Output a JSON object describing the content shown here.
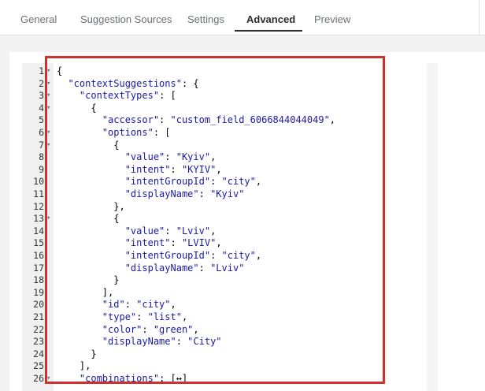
{
  "tabs": [
    {
      "label": "General",
      "active": false
    },
    {
      "label": "Suggestion Sources",
      "active": false
    },
    {
      "label": "Settings",
      "active": false
    },
    {
      "label": "Advanced",
      "active": true
    },
    {
      "label": "Preview",
      "active": false
    }
  ],
  "editor": {
    "lines": [
      {
        "num": "1",
        "fold": true,
        "text": "{"
      },
      {
        "num": "2",
        "fold": true,
        "text": "  \"contextSuggestions\": {"
      },
      {
        "num": "3",
        "fold": true,
        "text": "    \"contextTypes\": ["
      },
      {
        "num": "4",
        "fold": true,
        "text": "      {"
      },
      {
        "num": "5",
        "fold": false,
        "text": "        \"accessor\": \"custom_field_6066844044049\","
      },
      {
        "num": "6",
        "fold": true,
        "text": "        \"options\": ["
      },
      {
        "num": "7",
        "fold": true,
        "text": "          {"
      },
      {
        "num": "8",
        "fold": false,
        "text": "            \"value\": \"Kyiv\","
      },
      {
        "num": "9",
        "fold": false,
        "text": "            \"intent\": \"KYIV\","
      },
      {
        "num": "10",
        "fold": false,
        "text": "            \"intentGroupId\": \"city\","
      },
      {
        "num": "11",
        "fold": false,
        "text": "            \"displayName\": \"Kyiv\""
      },
      {
        "num": "12",
        "fold": false,
        "text": "          },"
      },
      {
        "num": "13",
        "fold": true,
        "text": "          {"
      },
      {
        "num": "14",
        "fold": false,
        "text": "            \"value\": \"Lviv\","
      },
      {
        "num": "15",
        "fold": false,
        "text": "            \"intent\": \"LVIV\","
      },
      {
        "num": "16",
        "fold": false,
        "text": "            \"intentGroupId\": \"city\","
      },
      {
        "num": "17",
        "fold": false,
        "text": "            \"displayName\": \"Lviv\""
      },
      {
        "num": "18",
        "fold": false,
        "text": "          }"
      },
      {
        "num": "19",
        "fold": false,
        "text": "        ],"
      },
      {
        "num": "20",
        "fold": false,
        "text": "        \"id\": \"city\","
      },
      {
        "num": "21",
        "fold": false,
        "text": "        \"type\": \"list\","
      },
      {
        "num": "22",
        "fold": false,
        "text": "        \"color\": \"green\","
      },
      {
        "num": "23",
        "fold": false,
        "text": "        \"displayName\": \"City\""
      },
      {
        "num": "24",
        "fold": false,
        "text": "      }"
      },
      {
        "num": "25",
        "fold": false,
        "text": "    ],"
      },
      {
        "num": "26",
        "fold": true,
        "text": "    \"combinations\": [↔]"
      }
    ]
  },
  "colors": {
    "highlight_border": "#d0312d",
    "active_tab_underline": "#2b2d31"
  }
}
